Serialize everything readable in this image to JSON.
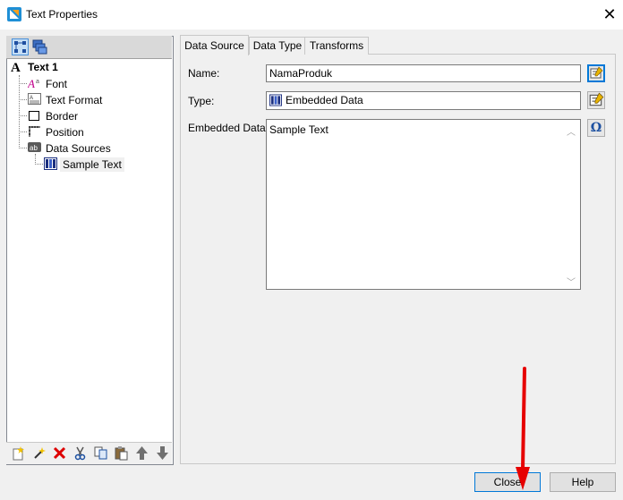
{
  "window": {
    "title": "Text Properties",
    "close_icon": "close-icon"
  },
  "tree": {
    "root": "Text 1",
    "items": [
      {
        "label": "Font",
        "icon": "font-icon"
      },
      {
        "label": "Text Format",
        "icon": "text-format-icon"
      },
      {
        "label": "Border",
        "icon": "border-icon"
      },
      {
        "label": "Position",
        "icon": "position-icon"
      },
      {
        "label": "Data Sources",
        "icon": "data-sources-icon"
      }
    ],
    "child": {
      "label": "Sample Text",
      "icon": "database-icon"
    }
  },
  "tabs": [
    "Data Source",
    "Data Type",
    "Transforms"
  ],
  "form": {
    "name_label": "Name:",
    "name_value": "NamaProduk",
    "type_label": "Type:",
    "type_value": "Embedded Data",
    "embedded_label": "Embedded Data:",
    "embedded_value": "Sample Text",
    "omega": "Ω"
  },
  "buttons": {
    "close": "Close",
    "help": "Help"
  },
  "colors": {
    "annotation_arrow": "#e60000",
    "accent": "#0078d7"
  }
}
